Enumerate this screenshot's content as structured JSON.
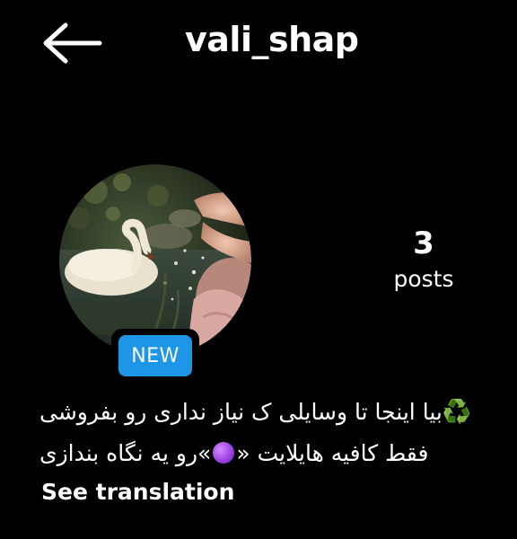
{
  "profile": {
    "username": "vali_shap",
    "badge": "NEW",
    "avatar_alt": "swan painting"
  },
  "stats": {
    "posts_count": "3",
    "posts_label": "posts"
  },
  "bio": {
    "line1_emoji": "♻️",
    "line1_text": "بیا اینجا تا وسایلی ک نیاز نداری رو بفروشی",
    "line2_text_a": "فقط کافیه هایلایت «",
    "line2_text_b": "»رو یه نگاه بندازی",
    "see_translation": "See translation"
  },
  "icons": {
    "back": "arrow-left-icon",
    "recycle": "recycle-icon",
    "purple_circle": "purple-circle-icon"
  },
  "colors": {
    "background": "#000000",
    "text": "#ffffff",
    "badge": "#1e96e8"
  }
}
